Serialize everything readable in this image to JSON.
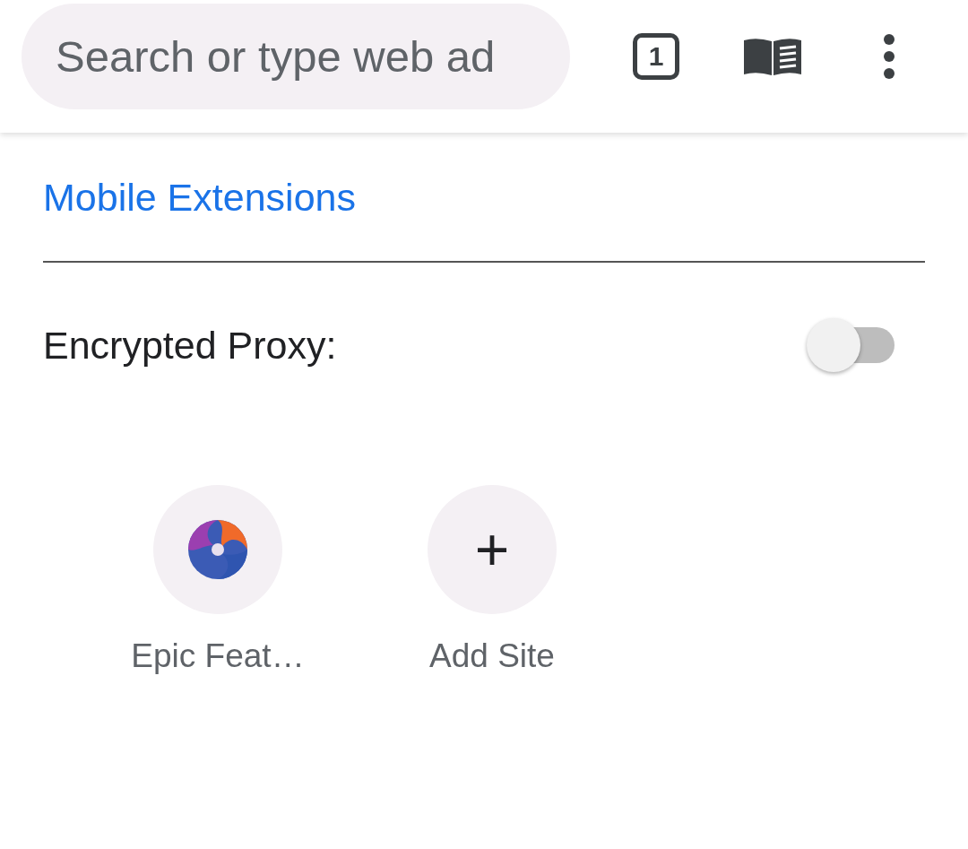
{
  "search": {
    "placeholder": "Search or type web ad"
  },
  "toolbar": {
    "tab_count": "1"
  },
  "section": {
    "title": "Mobile Extensions"
  },
  "proxy": {
    "label": "Encrypted Proxy:",
    "on": false
  },
  "shortcuts": [
    {
      "kind": "site",
      "label": "Epic Feat…"
    },
    {
      "kind": "add",
      "icon": "+",
      "label": "Add Site"
    }
  ]
}
